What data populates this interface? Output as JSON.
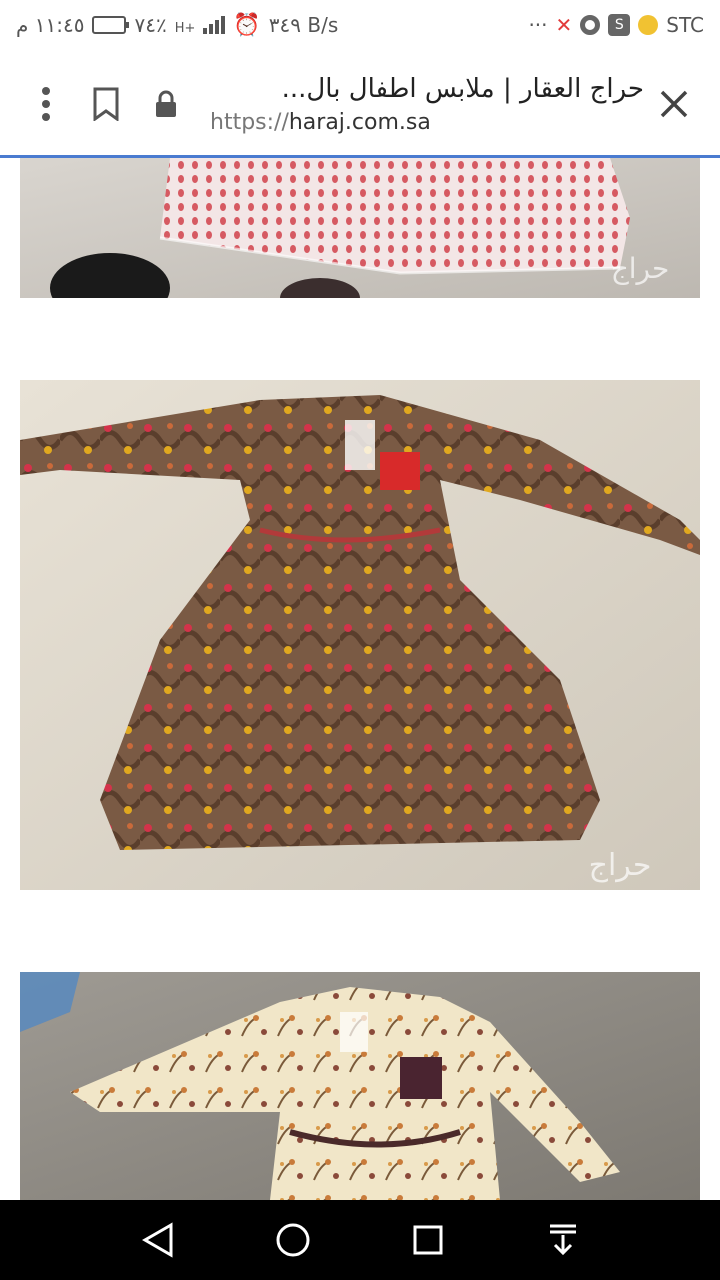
{
  "status_bar": {
    "carrier": "STC",
    "speed": "٣٤٩ B/s",
    "battery": "٧٤٪",
    "network": "H+",
    "time": "١١:٤٥ م",
    "overflow": "···",
    "icons": [
      "alarm-icon",
      "signal-icon",
      "battery-icon",
      "chrome-icon",
      "s-app-icon",
      "coin-icon",
      "close-notification-icon"
    ]
  },
  "browser": {
    "title": "حراج العقار | ملابس اطفال بال...",
    "url_scheme": "https://",
    "url_host": "haraj.com.sa",
    "icons": [
      "close-icon",
      "lock-icon",
      "bookmark-icon",
      "menu-icon"
    ]
  },
  "photos": [
    {
      "watermark": "حراج",
      "subject": "pink-white-dress"
    },
    {
      "watermark": "حراج",
      "subject": "brown-floral-dress"
    },
    {
      "watermark": "",
      "subject": "cream-floral-dress"
    }
  ],
  "nav_bar": {
    "icons": [
      "back-icon",
      "home-icon",
      "recents-icon",
      "notifications-pull-icon"
    ]
  },
  "colors": {
    "accent": "#4a7bd0",
    "nav_bg": "#000000"
  }
}
